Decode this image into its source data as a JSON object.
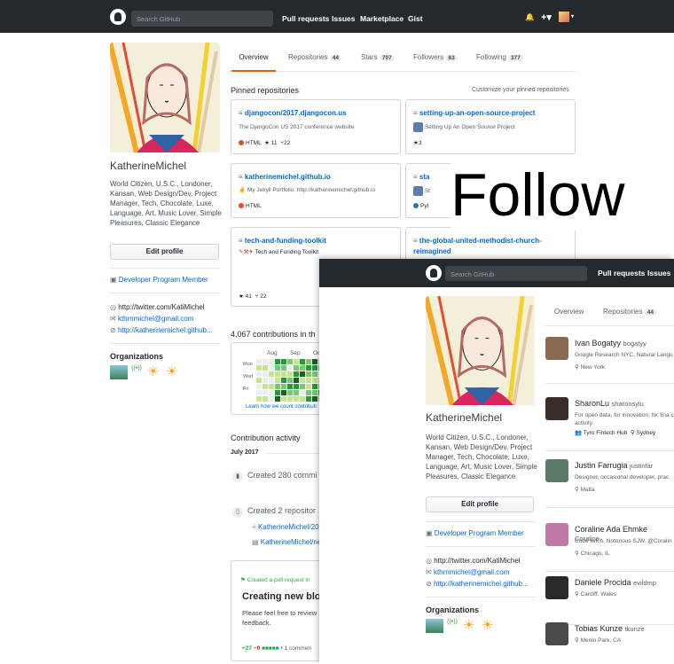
{
  "nav": {
    "search_placeholder": "Search GitHub",
    "links": [
      "Pull requests",
      "Issues",
      "Marketplace",
      "Gist"
    ]
  },
  "profile": {
    "name": "KatherineMichel",
    "bio": "World Citizen, U.S.C., Londoner, Kansan, Web Design/Dev, Project Manager, Tech, Chocolate, Luxe, Language, Art, Music Lover, Simple Pleasures, Classic Elegance",
    "edit_label": "Edit profile",
    "dev_program": "Developer Program Member",
    "twitter": "http://twitter.com/KatiMichel",
    "email": "kthrnmichel@gmail.com",
    "website": "http://katherinemichel.github...",
    "org_title": "Organizations"
  },
  "tabs": [
    {
      "label": "Overview",
      "count": ""
    },
    {
      "label": "Repositories",
      "count": "44"
    },
    {
      "label": "Stars",
      "count": "707"
    },
    {
      "label": "Followers",
      "count": "63"
    },
    {
      "label": "Following",
      "count": "377"
    }
  ],
  "pinned": {
    "title": "Pinned repositories",
    "customize": "Customize your pinned repositories",
    "repos": [
      {
        "name": "djangocon/2017.djangocon.us",
        "desc": "The DjangoCon US 2017 conference website",
        "lang": "HTML",
        "lang_color": "#e34c26",
        "stars": "11",
        "forks": "22"
      },
      {
        "name": "setting-up-an-open-source-project",
        "desc": "Setting Up An Open Source Project",
        "stars": "3"
      },
      {
        "name": "katherinemichel.github.io",
        "desc": "My Jekyll Portfolio: http://katherinemichel.github.io",
        "lang": "HTML",
        "lang_color": "#e34c26"
      },
      {
        "name": "sta",
        "desc": "St",
        "lang": "Pyt",
        "lang_color": "#3572A5"
      },
      {
        "name": "tech-and-funding-toolkit",
        "desc": "Tech and Funding Toolkit",
        "stars": "41",
        "forks": "22"
      },
      {
        "name": "the-global-united-methodist-church-reimagined",
        "desc": ""
      }
    ]
  },
  "contrib": {
    "title": "4,067 contributions in th",
    "months": [
      "Aug",
      "Sep",
      "Oc"
    ],
    "days": [
      "Mon",
      "Wed",
      "Fri"
    ],
    "learn": "Learn how we count contributi",
    "activity_title": "Contribution activity",
    "period": "July 2017",
    "created_commits": "Created 280 commi",
    "created_repos": "Created 2 repositor",
    "repo1": "KatherineMichel/20",
    "repo2": "KatherineMichel/ne",
    "pr_label": "Created a pull request in",
    "pr_title": "Creating new blog",
    "pr_body": "Please feel free to review feedback.",
    "diff_add": "+27",
    "diff_del": "−0",
    "comments": "1 commen"
  },
  "overlay_text": "Follow",
  "second": {
    "search_placeholder": "Search GitHub",
    "nav": [
      "Pull requests",
      "Issues"
    ],
    "tabs": [
      {
        "label": "Overview",
        "count": ""
      },
      {
        "label": "Repositories",
        "count": "44"
      }
    ],
    "followers": [
      {
        "name": "Ivan Bogatyy",
        "login": "bogatyy",
        "desc": "Google Research NYC, Natural Langu",
        "loc": "New York",
        "color": "#8a6b52"
      },
      {
        "name": "SharonLu",
        "login": "sharonsylu",
        "desc": "For open data, for innovation, for fina c activity.",
        "company": "Tyro Fintech Hub",
        "loc": "Sydney",
        "color": "#3b2d2a"
      },
      {
        "name": "Justin Farrugia",
        "login": "justinfar",
        "desc": "Designer, occasional developer, prac",
        "loc": "Malta",
        "color": "#5c7a6a"
      },
      {
        "name": "Coraline Ada Ehmke",
        "login": "Coraline",
        "desc": "Code witch. Notorious SJW. @Coralin",
        "loc": "Chicago, IL",
        "color": "#c07aa8"
      },
      {
        "name": "Daniele Procida",
        "login": "evildmp",
        "desc": "",
        "loc": "Cardiff, Wales",
        "color": "#2a2a2a"
      },
      {
        "name": "Tobias Kunze",
        "login": "tkunze",
        "desc": "",
        "loc": "Menlo Park, CA",
        "color": "#4a4a4a"
      }
    ]
  }
}
